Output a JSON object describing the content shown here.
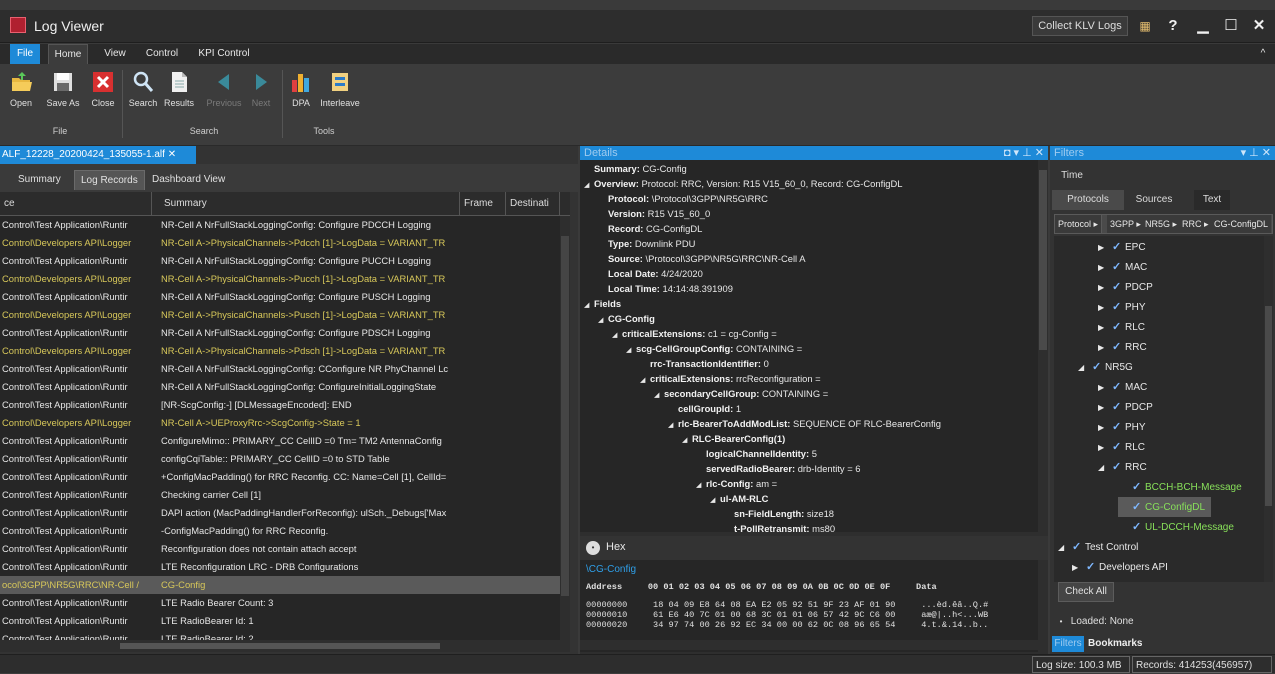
{
  "window": {
    "title": "Log Viewer",
    "collect_klv": "Collect KLV Logs",
    "help": "?",
    "minimize": "▁",
    "maximize": "☐",
    "close": "✕"
  },
  "menu": {
    "file": "File",
    "home": "Home",
    "view": "View",
    "control": "Control",
    "kpi": "KPI Control",
    "collapse": "^"
  },
  "ribbon": {
    "open": "Open",
    "save_as": "Save As",
    "close": "Close",
    "search": "Search",
    "results": "Results",
    "previous": "Previous",
    "next": "Next",
    "dpa": "DPA",
    "interleave": "Interleave",
    "group_file": "File",
    "group_search": "Search",
    "group_tools": "Tools"
  },
  "left": {
    "doc_tab": "ALF_12228_20200424_135055-1.alf ✕",
    "tabs": [
      "Summary",
      "Log Records",
      "Dashboard View"
    ],
    "columns": [
      "ce",
      "Summary",
      "Frame",
      "Destinati"
    ],
    "rows": [
      {
        "source": "Control\\Test Application\\Runtir",
        "summary": "NR-Cell A NrFullStackLoggingConfig: Configure PDCCH Logging",
        "style": "w"
      },
      {
        "source": "Control\\Developers API\\Logger",
        "summary": "NR-Cell A->PhysicalChannels->Pdcch [1]->LogData = VARIANT_TR",
        "style": "y"
      },
      {
        "source": "Control\\Test Application\\Runtir",
        "summary": "NR-Cell A NrFullStackLoggingConfig: Configure PUCCH Logging",
        "style": "w"
      },
      {
        "source": "Control\\Developers API\\Logger",
        "summary": "NR-Cell A->PhysicalChannels->Pucch [1]->LogData = VARIANT_TR",
        "style": "y"
      },
      {
        "source": "Control\\Test Application\\Runtir",
        "summary": "NR-Cell A NrFullStackLoggingConfig: Configure PUSCH Logging",
        "style": "w"
      },
      {
        "source": "Control\\Developers API\\Logger",
        "summary": "NR-Cell A->PhysicalChannels->Pusch [1]->LogData = VARIANT_TR",
        "style": "y"
      },
      {
        "source": "Control\\Test Application\\Runtir",
        "summary": "NR-Cell A NrFullStackLoggingConfig: Configure PDSCH Logging",
        "style": "w"
      },
      {
        "source": "Control\\Developers API\\Logger",
        "summary": "NR-Cell A->PhysicalChannels->Pdsch [1]->LogData = VARIANT_TR",
        "style": "y"
      },
      {
        "source": "Control\\Test Application\\Runtir",
        "summary": "NR-Cell A NrFullStackLoggingConfig: CConfigure NR PhyChannel Lc",
        "style": "w"
      },
      {
        "source": "Control\\Test Application\\Runtir",
        "summary": "NR-Cell A NrFullStackLoggingConfig: ConfigureInitialLoggingState",
        "style": "w"
      },
      {
        "source": "Control\\Test Application\\Runtir",
        "summary": "[NR-ScgConfig:-] [DLMessageEncoded]: END",
        "style": "w"
      },
      {
        "source": "Control\\Developers API\\Logger",
        "summary": "NR-Cell A->UEProxyRrc->ScgConfig->State = 1",
        "style": "y"
      },
      {
        "source": "Control\\Test Application\\Runtir",
        "summary": "ConfigureMimo:: PRIMARY_CC CellID =0  Tm= TM2 AntennaConfig",
        "style": "w"
      },
      {
        "source": "Control\\Test Application\\Runtir",
        "summary": "configCqiTable:: PRIMARY_CC CellID =0 to STD Table",
        "style": "w"
      },
      {
        "source": "Control\\Test Application\\Runtir",
        "summary": "+ConfigMacPadding() for RRC Reconfig. CC: Name=Cell [1], CellId=",
        "style": "w"
      },
      {
        "source": "Control\\Test Application\\Runtir",
        "summary": "Checking carrier Cell [1]",
        "style": "w"
      },
      {
        "source": "Control\\Test Application\\Runtir",
        "summary": "DAPI action (MacPaddingHandlerForReconfig): ulSch._Debugs['Max",
        "style": "w"
      },
      {
        "source": "Control\\Test Application\\Runtir",
        "summary": "-ConfigMacPadding() for RRC Reconfig.",
        "style": "w"
      },
      {
        "source": "Control\\Test Application\\Runtir",
        "summary": "Reconfiguration does not contain attach accept",
        "style": "w"
      },
      {
        "source": "Control\\Test Application\\Runtir",
        "summary": "LTE Reconfiguration LRC - DRB Configurations",
        "style": "w"
      },
      {
        "source": "ocol\\3GPP\\NR5G\\RRC\\NR-Cell /",
        "summary": "CG-Config",
        "style": "sel"
      },
      {
        "source": "Control\\Test Application\\Runtir",
        "summary": "LTE Radio Bearer Count: 3",
        "style": "w"
      },
      {
        "source": "Control\\Test Application\\Runtir",
        "summary": "LTE RadioBearer Id: 1",
        "style": "w"
      },
      {
        "source": "Control\\Test Application\\Runtir",
        "summary": "LTE RadioBearer Id: 2",
        "style": "w"
      }
    ]
  },
  "details": {
    "title": "Details",
    "head_icons": "◘ ▾ ⊥ ✕",
    "lines": [
      {
        "lvl": 0,
        "arrow": "",
        "label": "Summary:",
        "value": "CG-Config"
      },
      {
        "lvl": 0,
        "arrow": "◢",
        "label": "Overview:",
        "value": "Protocol: RRC, Version: R15 V15_60_0, Record: CG-ConfigDL"
      },
      {
        "lvl": 1,
        "arrow": "",
        "label": "Protocol:",
        "value": "\\Protocol\\3GPP\\NR5G\\RRC"
      },
      {
        "lvl": 1,
        "arrow": "",
        "label": "Version:",
        "value": "R15 V15_60_0"
      },
      {
        "lvl": 1,
        "arrow": "",
        "label": "Record:",
        "value": "CG-ConfigDL"
      },
      {
        "lvl": 1,
        "arrow": "",
        "label": "Type:",
        "value": "Downlink PDU"
      },
      {
        "lvl": 1,
        "arrow": "",
        "label": "Source:",
        "value": "\\Protocol\\3GPP\\NR5G\\RRC\\NR-Cell A"
      },
      {
        "lvl": 1,
        "arrow": "",
        "label": "Local Date:",
        "value": "4/24/2020"
      },
      {
        "lvl": 1,
        "arrow": "",
        "label": "Local Time:",
        "value": "14:14:48.391909"
      },
      {
        "lvl": 0,
        "arrow": "◢",
        "label": "Fields",
        "value": ""
      },
      {
        "lvl": 1,
        "arrow": "◢",
        "label": "CG-Config",
        "value": ""
      },
      {
        "lvl": 2,
        "arrow": "◢",
        "label": "criticalExtensions:",
        "value": "c1 = cg-Config ="
      },
      {
        "lvl": 3,
        "arrow": "◢",
        "label": "scg-CellGroupConfig:",
        "value": "CONTAINING ="
      },
      {
        "lvl": 4,
        "arrow": "",
        "label": "rrc-TransactionIdentifier:",
        "value": "0"
      },
      {
        "lvl": 4,
        "arrow": "◢",
        "label": "criticalExtensions:",
        "value": "rrcReconfiguration ="
      },
      {
        "lvl": 5,
        "arrow": "◢",
        "label": "secondaryCellGroup:",
        "value": "CONTAINING ="
      },
      {
        "lvl": 6,
        "arrow": "",
        "label": "cellGroupId:",
        "value": "1"
      },
      {
        "lvl": 6,
        "arrow": "◢",
        "label": "rlc-BearerToAddModList:",
        "value": "SEQUENCE OF RLC-BearerConfig"
      },
      {
        "lvl": 7,
        "arrow": "◢",
        "label": "RLC-BearerConfig(1)",
        "value": ""
      },
      {
        "lvl": 8,
        "arrow": "",
        "label": "logicalChannelIdentity:",
        "value": "5"
      },
      {
        "lvl": 8,
        "arrow": "",
        "label": "servedRadioBearer:",
        "value": "drb-Identity = 6"
      },
      {
        "lvl": 8,
        "arrow": "◢",
        "label": "rlc-Config:",
        "value": "am ="
      },
      {
        "lvl": 9,
        "arrow": "◢",
        "label": "ul-AM-RLC",
        "value": ""
      },
      {
        "lvl": 10,
        "arrow": "",
        "label": "sn-FieldLength:",
        "value": "size18"
      },
      {
        "lvl": 10,
        "arrow": "",
        "label": "t-PollRetransmit:",
        "value": "ms80"
      }
    ]
  },
  "hex": {
    "title": "Hex",
    "path": "\\CG-Config",
    "header": "Address     00 01 02 03 04 05 06 07 08 09 0A 0B 0C 0D 0E 0F     Data",
    "rows": [
      "00000000     18 04 09 E8 64 08 EA E2 05 92 51 9F 23 AF 01 90     ...èd.êâ..Q.#",
      "00000010     61 E6 40 7C 01 00 68 3C 01 01 06 57 42 9C C6 00     aæ@|..h<...WB",
      "00000020     34 97 74 00 26 92 EC 34 00 00 62 0C 08 96 65 54     4.t.&.14..b.."
    ]
  },
  "filters": {
    "title": "Filters",
    "head_icons": "▾ ⊥ ✕",
    "tab_time": "Time",
    "tabs": [
      "Protocols",
      "Sources",
      "Text"
    ],
    "breadcrumb": [
      "Protocol",
      "3GPP",
      "NR5G",
      "RRC",
      "CG-ConfigDL"
    ],
    "nodes": [
      {
        "lvl": 2,
        "arrow": "▶",
        "label": "EPC",
        "style": ""
      },
      {
        "lvl": 2,
        "arrow": "▶",
        "label": "MAC",
        "style": ""
      },
      {
        "lvl": 2,
        "arrow": "▶",
        "label": "PDCP",
        "style": ""
      },
      {
        "lvl": 2,
        "arrow": "▶",
        "label": "PHY",
        "style": ""
      },
      {
        "lvl": 2,
        "arrow": "▶",
        "label": "RLC",
        "style": ""
      },
      {
        "lvl": 2,
        "arrow": "▶",
        "label": "RRC",
        "style": ""
      },
      {
        "lvl": 1,
        "arrow": "◢",
        "label": "NR5G",
        "style": ""
      },
      {
        "lvl": 2,
        "arrow": "▶",
        "label": "MAC",
        "style": ""
      },
      {
        "lvl": 2,
        "arrow": "▶",
        "label": "PDCP",
        "style": ""
      },
      {
        "lvl": 2,
        "arrow": "▶",
        "label": "PHY",
        "style": ""
      },
      {
        "lvl": 2,
        "arrow": "▶",
        "label": "RLC",
        "style": ""
      },
      {
        "lvl": 2,
        "arrow": "◢",
        "label": "RRC",
        "style": ""
      },
      {
        "lvl": 3,
        "arrow": "",
        "label": "BCCH-BCH-Message",
        "style": "g"
      },
      {
        "lvl": 3,
        "arrow": "",
        "label": "CG-ConfigDL",
        "style": "gsel"
      },
      {
        "lvl": 3,
        "arrow": "",
        "label": "UL-DCCH-Message",
        "style": "g"
      },
      {
        "lvl": 0,
        "arrow": "◢",
        "label": "Test Control",
        "style": ""
      },
      {
        "lvl": 0.7,
        "arrow": "▶",
        "label": "Developers API",
        "style": ""
      }
    ],
    "check_all": "Check All",
    "loaded": "Loaded: None",
    "bottom_tabs": [
      "Filters",
      "Bookmarks"
    ]
  },
  "status": {
    "log_size": "Log size: 100.3 MB",
    "records": "Records: 414253(456957)"
  },
  "colors": {
    "accent": "#1e8ad8",
    "highlight_text": "#d8c85a",
    "selected_filter": "#88e05a"
  }
}
